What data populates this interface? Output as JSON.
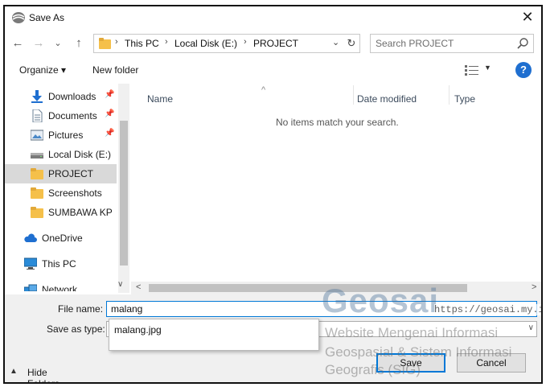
{
  "window": {
    "title": "Save As",
    "close_symbol": "✕"
  },
  "navigation": {
    "back_symbol": "←",
    "forward_symbol": "→",
    "recent_symbol": "⌄",
    "up_symbol": "↑",
    "breadcrumbs": [
      "This PC",
      "Local Disk (E:)",
      "PROJECT"
    ],
    "crumb_separator": "›",
    "dropdown_symbol": "⌄",
    "refresh_symbol": "↻"
  },
  "search": {
    "placeholder": "Search PROJECT"
  },
  "toolbar": {
    "organize_label": "Organize ▾",
    "new_folder_label": "New folder",
    "view_dropdown_symbol": "▼",
    "help_symbol": "?"
  },
  "sidebar": {
    "quick_access": [
      {
        "label": "Downloads",
        "icon": "download-arrow-icon",
        "pinned": true
      },
      {
        "label": "Documents",
        "icon": "document-icon",
        "pinned": true
      },
      {
        "label": "Pictures",
        "icon": "pictures-icon",
        "pinned": true
      },
      {
        "label": "Local Disk (E:)",
        "icon": "drive-icon",
        "pinned": false
      },
      {
        "label": "PROJECT",
        "icon": "folder-icon",
        "pinned": false,
        "selected": true
      },
      {
        "label": "Screenshots",
        "icon": "folder-icon",
        "pinned": false
      },
      {
        "label": "SUMBAWA KP",
        "icon": "folder-icon",
        "pinned": false
      }
    ],
    "onedrive": "OneDrive",
    "this_pc": "This PC",
    "network": "Network",
    "pin_symbol": "📌"
  },
  "file_list": {
    "columns": [
      "Name",
      "Date modified",
      "Type"
    ],
    "sort_indicator": "^",
    "empty_message": "No items match your search."
  },
  "scroll": {
    "left_symbol": "<",
    "right_symbol": ">",
    "down_symbol": "∨"
  },
  "form": {
    "file_name_label": "File name:",
    "file_name_value": "malang",
    "save_as_type_label": "Save as type:",
    "save_as_type_chevron": "∨",
    "suggestion": "malang.jpg"
  },
  "footer": {
    "hide_folders_label": "Hide Folders",
    "hide_folders_caret": "▲",
    "save_label": "Save",
    "cancel_label": "Cancel"
  },
  "watermark": {
    "title": "Geosai",
    "url": "https://geosai.my.id",
    "line1": "Website Mengenai Informasi",
    "line2": "Geospasial & Sistem Informasi",
    "line3": "Geografis (SIG)"
  },
  "colors": {
    "accent": "#0078d7",
    "folder": "#f5c04a",
    "help": "#1f6fd0",
    "selected_row": "#d9d9d9",
    "footer_bg": "#f0f0f0"
  }
}
